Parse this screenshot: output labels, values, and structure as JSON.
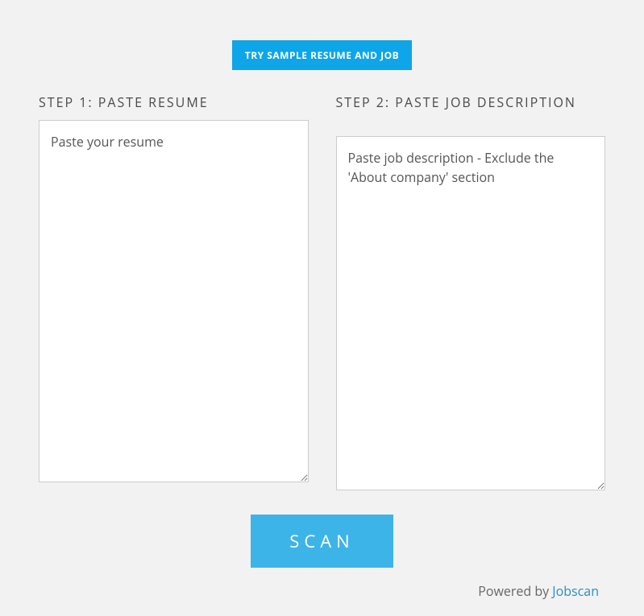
{
  "top_button_label": "TRY SAMPLE RESUME AND JOB",
  "step1": {
    "heading": "STEP 1: PASTE RESUME",
    "placeholder": "Paste your resume"
  },
  "step2": {
    "heading": "STEP 2: PASTE JOB DESCRIPTION",
    "placeholder": "Paste job description - Exclude the 'About company' section"
  },
  "scan_button_label": "SCAN",
  "footer": {
    "prefix": "Powered by ",
    "link_text": "Jobscan"
  }
}
